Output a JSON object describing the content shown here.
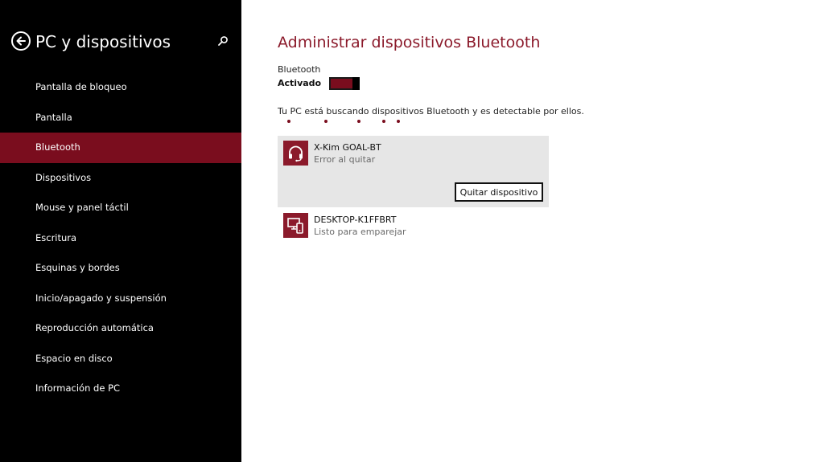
{
  "sidebar": {
    "title": "PC y dispositivos",
    "back_icon": "back-arrow-icon",
    "search_icon": "search-icon",
    "items": [
      {
        "label": "Pantalla de bloqueo",
        "selected": false
      },
      {
        "label": "Pantalla",
        "selected": false
      },
      {
        "label": "Bluetooth",
        "selected": true
      },
      {
        "label": "Dispositivos",
        "selected": false
      },
      {
        "label": "Mouse y panel táctil",
        "selected": false
      },
      {
        "label": "Escritura",
        "selected": false
      },
      {
        "label": "Esquinas y bordes",
        "selected": false
      },
      {
        "label": "Inicio/apagado y suspensión",
        "selected": false
      },
      {
        "label": "Reproducción automática",
        "selected": false
      },
      {
        "label": "Espacio en disco",
        "selected": false
      },
      {
        "label": "Información de PC",
        "selected": false
      }
    ]
  },
  "main": {
    "title": "Administrar dispositivos Bluetooth",
    "bluetooth_label": "Bluetooth",
    "bluetooth_state": "Activado",
    "bluetooth_on": true,
    "status_text": "Tu PC está buscando dispositivos Bluetooth y es detectable por ellos.",
    "devices": [
      {
        "name": "X-Kim GOAL-BT",
        "status": "Error al quitar",
        "icon": "headset-icon",
        "selected": true,
        "action_label": "Quitar dispositivo"
      },
      {
        "name": "DESKTOP-K1FFBRT",
        "status": "Listo para emparejar",
        "icon": "computer-phone-icon",
        "selected": false
      }
    ]
  },
  "colors": {
    "accent": "#7a0d1e",
    "title": "#8b1a2b",
    "sidebar_bg": "#000000",
    "selected_device_bg": "#e6e6e6"
  }
}
